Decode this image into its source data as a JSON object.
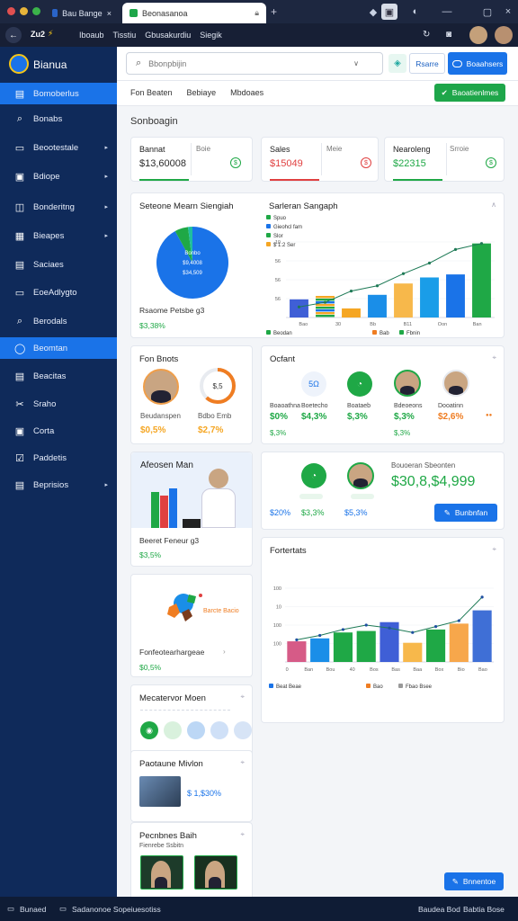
{
  "browser": {
    "tab1_title": "Bau Bangeletian",
    "tab2_title": "Beonasanoa",
    "address_crumbs": [
      "Iboaub",
      "Tisstiu",
      "Gbusakurdiu",
      "Siegik"
    ],
    "address_logo": "Zu2"
  },
  "app": {
    "title": "Bianua"
  },
  "sidebar": {
    "items": [
      {
        "label": "Bomoberlus",
        "icon": "▤",
        "active": true,
        "chevron": false
      },
      {
        "label": "Bonabs",
        "icon": "⌕",
        "active": false,
        "chevron": false
      },
      {
        "label": "Beootestale",
        "icon": "▭",
        "active": false,
        "chevron": true
      },
      {
        "label": "Bdiope",
        "icon": "▣",
        "active": false,
        "chevron": true
      },
      {
        "label": "Bonderitng",
        "icon": "◫",
        "active": false,
        "chevron": true
      },
      {
        "label": "Bieapes",
        "icon": "▦",
        "active": false,
        "chevron": true
      },
      {
        "label": "Saciaes",
        "icon": "▤",
        "active": false,
        "chevron": false
      },
      {
        "label": "EoeAdlygto",
        "icon": "▭",
        "active": false,
        "chevron": false
      },
      {
        "label": "Berodals",
        "icon": "⌕",
        "active": false,
        "chevron": false
      },
      {
        "label": "Beomtan",
        "icon": "◯",
        "active": true,
        "chevron": false
      },
      {
        "label": "Beacitas",
        "icon": "▤",
        "active": false,
        "chevron": false
      },
      {
        "label": "Sraho",
        "icon": "✂",
        "active": false,
        "chevron": false
      },
      {
        "label": "Corta",
        "icon": "▣",
        "active": false,
        "chevron": false
      },
      {
        "label": "Paddetis",
        "icon": "☑",
        "active": false,
        "chevron": false
      },
      {
        "label": "Beprisios",
        "icon": "▤",
        "active": false,
        "chevron": true
      }
    ]
  },
  "search": {
    "placeholder": "Bbonpbijin"
  },
  "header": {
    "filter_label": "Rsarre",
    "primary_label": "Boaahsers",
    "new_button": "Baoatienlmes"
  },
  "subnav": {
    "tabs": [
      "Fon Beaten",
      "Bebiaye",
      "Mbdoaes"
    ]
  },
  "section_title": "Sonboagin",
  "kpis": [
    {
      "title": "Bannat",
      "sub": "Boie",
      "value": "$13,60008",
      "color": "#2b2b2b",
      "accent": "#1fa846"
    },
    {
      "title": "Sales",
      "sub": "Meie",
      "value": "$15049",
      "color": "#e04040",
      "accent": "#e04040"
    },
    {
      "title": "Nearoleng",
      "sub": "Srroie",
      "value": "$22315",
      "color": "#1fa846",
      "accent": "#1fa846"
    }
  ],
  "donut_card": {
    "title": "Seteone Mearn Siengiah",
    "center_lines": [
      "Bonbo",
      "$9,4008",
      "$34,509"
    ],
    "footer_label": "Rsaome Petsbe ɡ3",
    "footer_value": "$3,38%",
    "segments": [
      {
        "value": 92,
        "color": "#1a73e8"
      },
      {
        "value": 6,
        "color": "#1fa846"
      },
      {
        "value": 2,
        "color": "#1fbf9f"
      }
    ]
  },
  "bar_chart_1": {
    "title": "Sarleran Sangaph",
    "legend_top": [
      "Spuo",
      "Gieohcl fam",
      "Slor",
      "$ 1:2 Ser"
    ],
    "yticks": [
      "56",
      "56",
      "56",
      "10"
    ],
    "xlabels": [
      "Bao",
      "30",
      "Bb",
      "B11",
      "Oon",
      "Ban"
    ],
    "values": [
      24,
      30,
      12,
      30,
      45,
      53,
      57,
      98
    ],
    "colors": [
      "#3f5fd6",
      "#1fa846",
      "#f5a623",
      "#1a8ee8",
      "#f7b84b",
      "#1a9de8",
      "#1a73e8",
      "#1fa846"
    ],
    "trend": [
      14,
      20,
      35,
      42,
      58,
      72,
      90,
      98
    ],
    "legend_bottom": [
      "Beodan",
      "Bab",
      "Fbnin"
    ]
  },
  "people_card": {
    "title": "Fon Bnots",
    "name1": "Beudanspen",
    "name2": "Bdbo Emb",
    "value1": "$0,5%",
    "value2": "$2,7%",
    "gauge_label": "$,5"
  },
  "team_card": {
    "title": "Ocfant",
    "values": [
      {
        "label": "Boaoathna",
        "value": "$0%",
        "color": "#1fa846"
      },
      {
        "label": "Boetecho",
        "value": "$4,3%",
        "color": "#1fa846"
      },
      {
        "label": "Boataeb",
        "value": "$,3%",
        "color": "#1fa846"
      },
      {
        "label": "Bdeoeons",
        "value": "$,3%",
        "color": "#1fa846"
      },
      {
        "label": "Dooatinn",
        "value": "$2,6%",
        "color": "#ef7d22"
      }
    ],
    "extra": [
      "$,3%",
      "$,3%"
    ],
    "trailing": "●●"
  },
  "promo_card": {
    "title": "Afeosen Man",
    "footer_label": "Beeret Feneur ɡ3",
    "footer_value": "$3,5%"
  },
  "summary_card": {
    "label": "Bouoeran Sbeonten",
    "big_value": "$30,8,$4,999",
    "small_values": [
      "$20%",
      "$3,3%",
      "$5,3%"
    ],
    "button": "Bunbnfan"
  },
  "map_card": {
    "map_label": "Barcte Bacio",
    "footer_label": "Fonfeotearhargeae",
    "footer_value": "$0,5%"
  },
  "bar_chart_2": {
    "title": "Fortertats",
    "yticks": [
      "100",
      "100",
      "10",
      "100"
    ],
    "xlabels": [
      "0",
      "Ban",
      "Bou",
      "40",
      "Bos",
      "Bas",
      "Baa",
      "Box",
      "Bio",
      "Bao"
    ],
    "values": [
      28,
      32,
      40,
      42,
      54,
      26,
      44,
      52,
      70
    ],
    "colors": [
      "#d65b87",
      "#1a8ee8",
      "#1fa846",
      "#1fa846",
      "#3f5fd6",
      "#f7b84b",
      "#1fa846",
      "#f7a74b",
      "#3f6fd6"
    ],
    "trend": [
      30,
      36,
      44,
      50,
      46,
      40,
      48,
      56,
      88
    ],
    "legend": [
      "Beat Beae",
      "Bao",
      "Fbao Bsee"
    ]
  },
  "mini_card_1": {
    "title": "Mecatervor Moen"
  },
  "mini_card_2": {
    "title": "Paotaune Mivlon",
    "value": "$ 1,$30%"
  },
  "mini_card_3": {
    "title": "Pecnbnes Baih",
    "sub": "Fienrebe Ssbitn"
  },
  "fab_label": "Bnnentoe",
  "statusbar": {
    "left1": "Bunaed",
    "left2": "Sadanonoe Sopeiuesotiss",
    "right1": "Baudea Bod",
    "right2": "Babtia Bose"
  }
}
